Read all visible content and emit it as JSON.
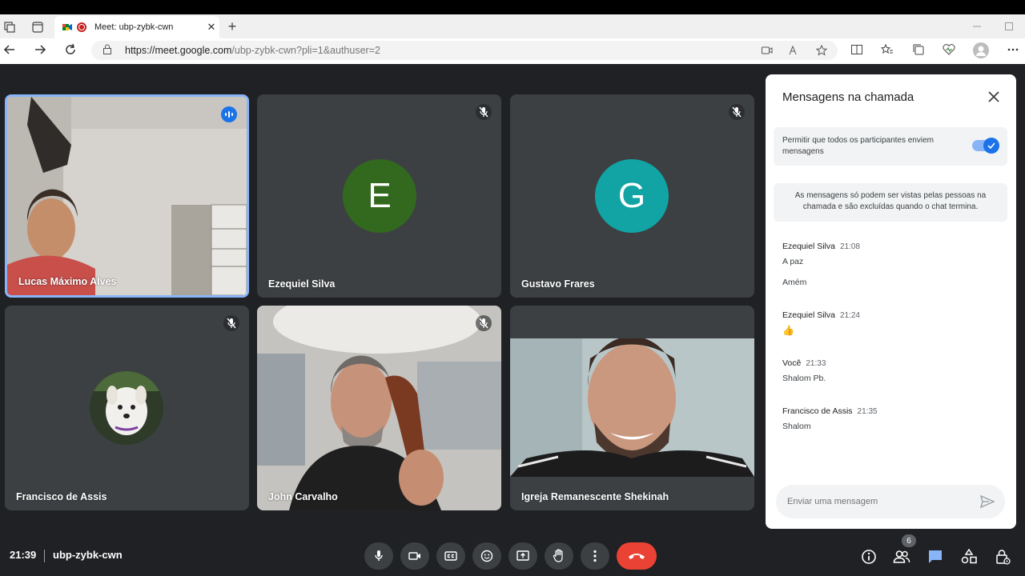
{
  "browser": {
    "tab_title": "Meet: ubp-zybk-cwn",
    "tab_close": "✕",
    "new_tab": "+",
    "url_host": "https://meet.google.com",
    "url_path": "/ubp-zybk-cwn?pli=1&authuser=2"
  },
  "participants": [
    {
      "name": "Lucas Máximo Alves",
      "speaking": true
    },
    {
      "name": "Ezequiel Silva",
      "initial": "E",
      "avatar_color": "#33691e"
    },
    {
      "name": "Gustavo Frares",
      "initial": "G",
      "avatar_color": "#12a4a4"
    },
    {
      "name": "Francisco de Assis"
    },
    {
      "name": "John Carvalho"
    },
    {
      "name": "Igreja Remanescente Shekinah"
    }
  ],
  "chat": {
    "title": "Mensagens na chamada",
    "permission_text": "Permitir que todos os participantes enviem mensagens",
    "permission_enabled": true,
    "info_text": "As mensagens só podem ser vistas pelas pessoas na chamada e são excluídas quando o chat termina.",
    "messages": [
      {
        "sender": "Ezequiel Silva",
        "time": "21:08",
        "lines": [
          "A paz",
          "Amém"
        ]
      },
      {
        "sender": "Ezequiel Silva",
        "time": "21:24",
        "lines": [
          "👍"
        ]
      },
      {
        "sender": "Você",
        "time": "21:33",
        "lines": [
          "Shalom Pb."
        ]
      },
      {
        "sender": "Francisco de Assis",
        "time": "21:35",
        "lines": [
          "Shalom"
        ]
      }
    ],
    "input_placeholder": "Enviar uma mensagem"
  },
  "bottom": {
    "clock": "21:39",
    "meeting_code": "ubp-zybk-cwn",
    "participant_count": "6"
  },
  "colors": {
    "accent": "#1a73e8",
    "hangup": "#ea4335",
    "background": "#202124",
    "tile": "#3c4043",
    "speaking_border": "#8ab4f8"
  }
}
